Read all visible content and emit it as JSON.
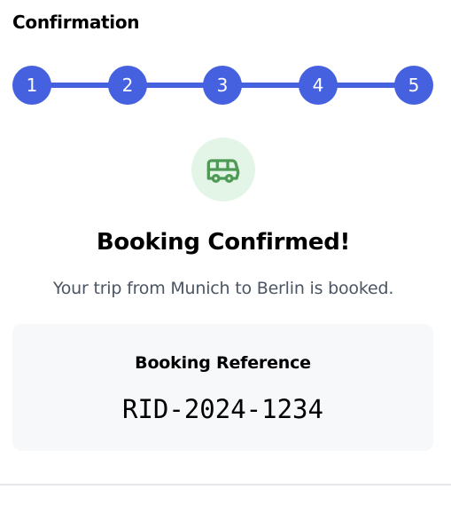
{
  "header": {
    "title": "Confirmation"
  },
  "stepper": {
    "steps": [
      "1",
      "2",
      "3",
      "4",
      "5"
    ],
    "active_color": "#4661e0"
  },
  "status": {
    "icon": "bus-icon",
    "icon_color": "#4f9a56",
    "icon_bg": "#e3f5e6",
    "heading": "Booking Confirmed!",
    "message": "Your trip from Munich to Berlin is booked."
  },
  "reference": {
    "label": "Booking Reference",
    "code": "RID-2024-1234"
  }
}
